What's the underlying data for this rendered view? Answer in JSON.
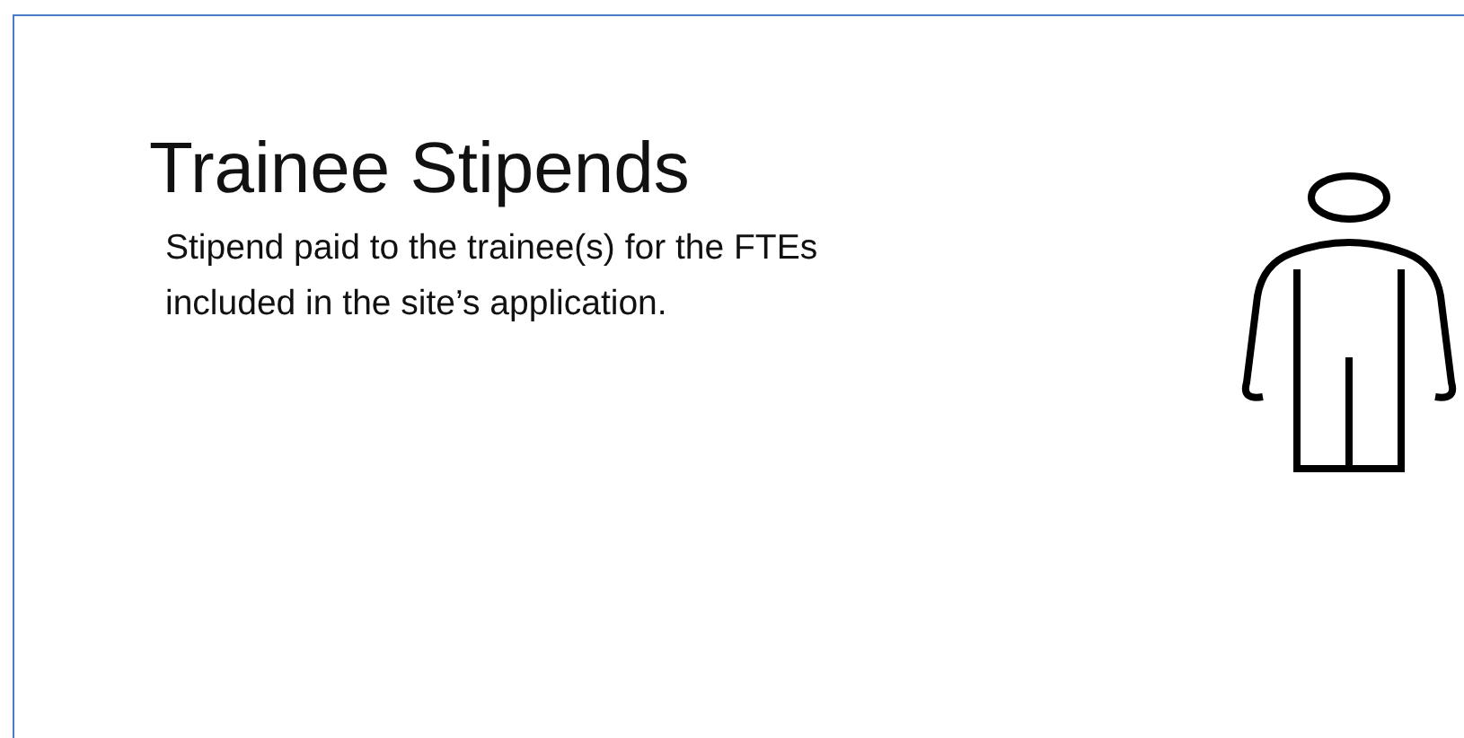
{
  "slide": {
    "title": "Trainee Stipends",
    "body": "Stipend paid to the trainee(s) for the FTEs included in the site’s application."
  }
}
